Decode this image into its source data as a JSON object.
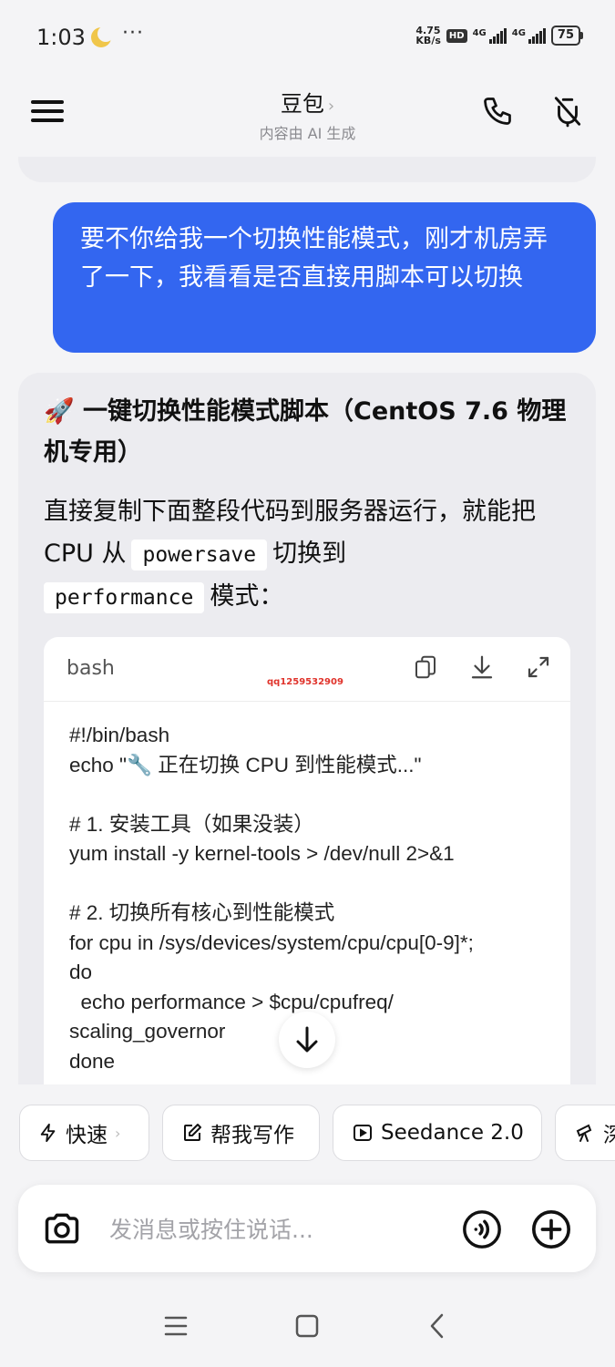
{
  "status_bar": {
    "time": "1:03",
    "dots": "···",
    "net_speed_value": "4.75",
    "net_speed_unit": "KB/s",
    "hd_label": "HD",
    "signal1_label": "4G",
    "signal2_label": "4G",
    "battery": "75"
  },
  "header": {
    "title": "豆包",
    "title_chevron": "›",
    "subtitle": "内容由 AI 生成"
  },
  "chat": {
    "user_message": "要不你给我一个切换性能模式，刚才机房弄了一下，我看看是否直接用脚本可以切换",
    "ai": {
      "heading_emoji": "🚀",
      "heading": "一键切换性能模式脚本（CentOS 7.6 物理机专用）",
      "intro_part1": "直接复制下面整段代码到服务器运行，就能把 CPU 从",
      "code_from": "powersave",
      "intro_part2": "切换到",
      "code_to": "performance",
      "intro_part3": "模式：",
      "code_block": {
        "language": "bash",
        "watermark": "qq1259532909",
        "lines": [
          "#!/bin/bash",
          "echo \"🔧 正在切换 CPU 到性能模式...\"",
          "",
          "# 1. 安装工具（如果没装）",
          "yum install -y kernel-tools > /dev/null 2>&1",
          "",
          "# 2. 切换所有核心到性能模式",
          "for cpu in /sys/devices/system/cpu/cpu[0-9]*;",
          "do",
          "  echo performance > $cpu/cpufreq/",
          "scaling_governor",
          "done"
        ]
      }
    }
  },
  "chips": [
    {
      "label": "快速",
      "icon": "lightning-icon",
      "chevron": "›"
    },
    {
      "label": "帮我写作",
      "icon": "edit-icon"
    },
    {
      "label": "Seedance 2.0",
      "icon": "play-icon"
    },
    {
      "label": "深",
      "icon": "telescope-icon"
    }
  ],
  "input": {
    "placeholder": "发消息或按住说话..."
  },
  "colors": {
    "accent": "#3366f0",
    "background": "#f4f4f6",
    "card": "#ececf0"
  }
}
